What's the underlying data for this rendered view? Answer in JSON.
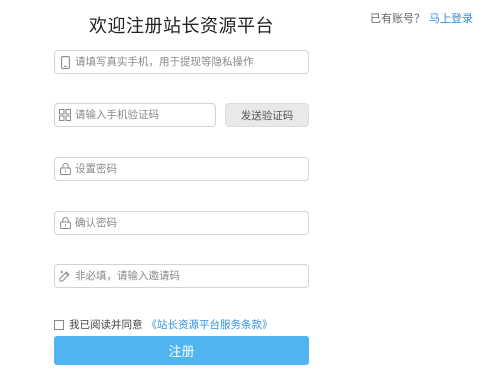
{
  "header": {
    "title": "欢迎注册站长资源平台",
    "has_account_text": "已有账号？",
    "login_link": "马上登录"
  },
  "form": {
    "phone_placeholder": "请填写真实手机，用于提现等隐私操作",
    "code_placeholder": "请输入手机验证码",
    "send_code_label": "发送验证码",
    "password_placeholder": "设置密码",
    "confirm_password_placeholder": "确认密码",
    "invite_placeholder": "非必填，请输入邀请码",
    "agree_text": "我已阅读并同意",
    "terms_link": "《站长资源平台服务条款》",
    "submit_label": "注册"
  },
  "colors": {
    "accent": "#4fb4ef",
    "link": "#2f8fe0",
    "border": "#cfd4da",
    "button_gray": "#e9e9e9"
  },
  "icons": {
    "phone": "phone-icon",
    "code": "grid-icon",
    "password": "lock-icon",
    "confirm": "lock-icon",
    "invite": "invite-icon"
  }
}
